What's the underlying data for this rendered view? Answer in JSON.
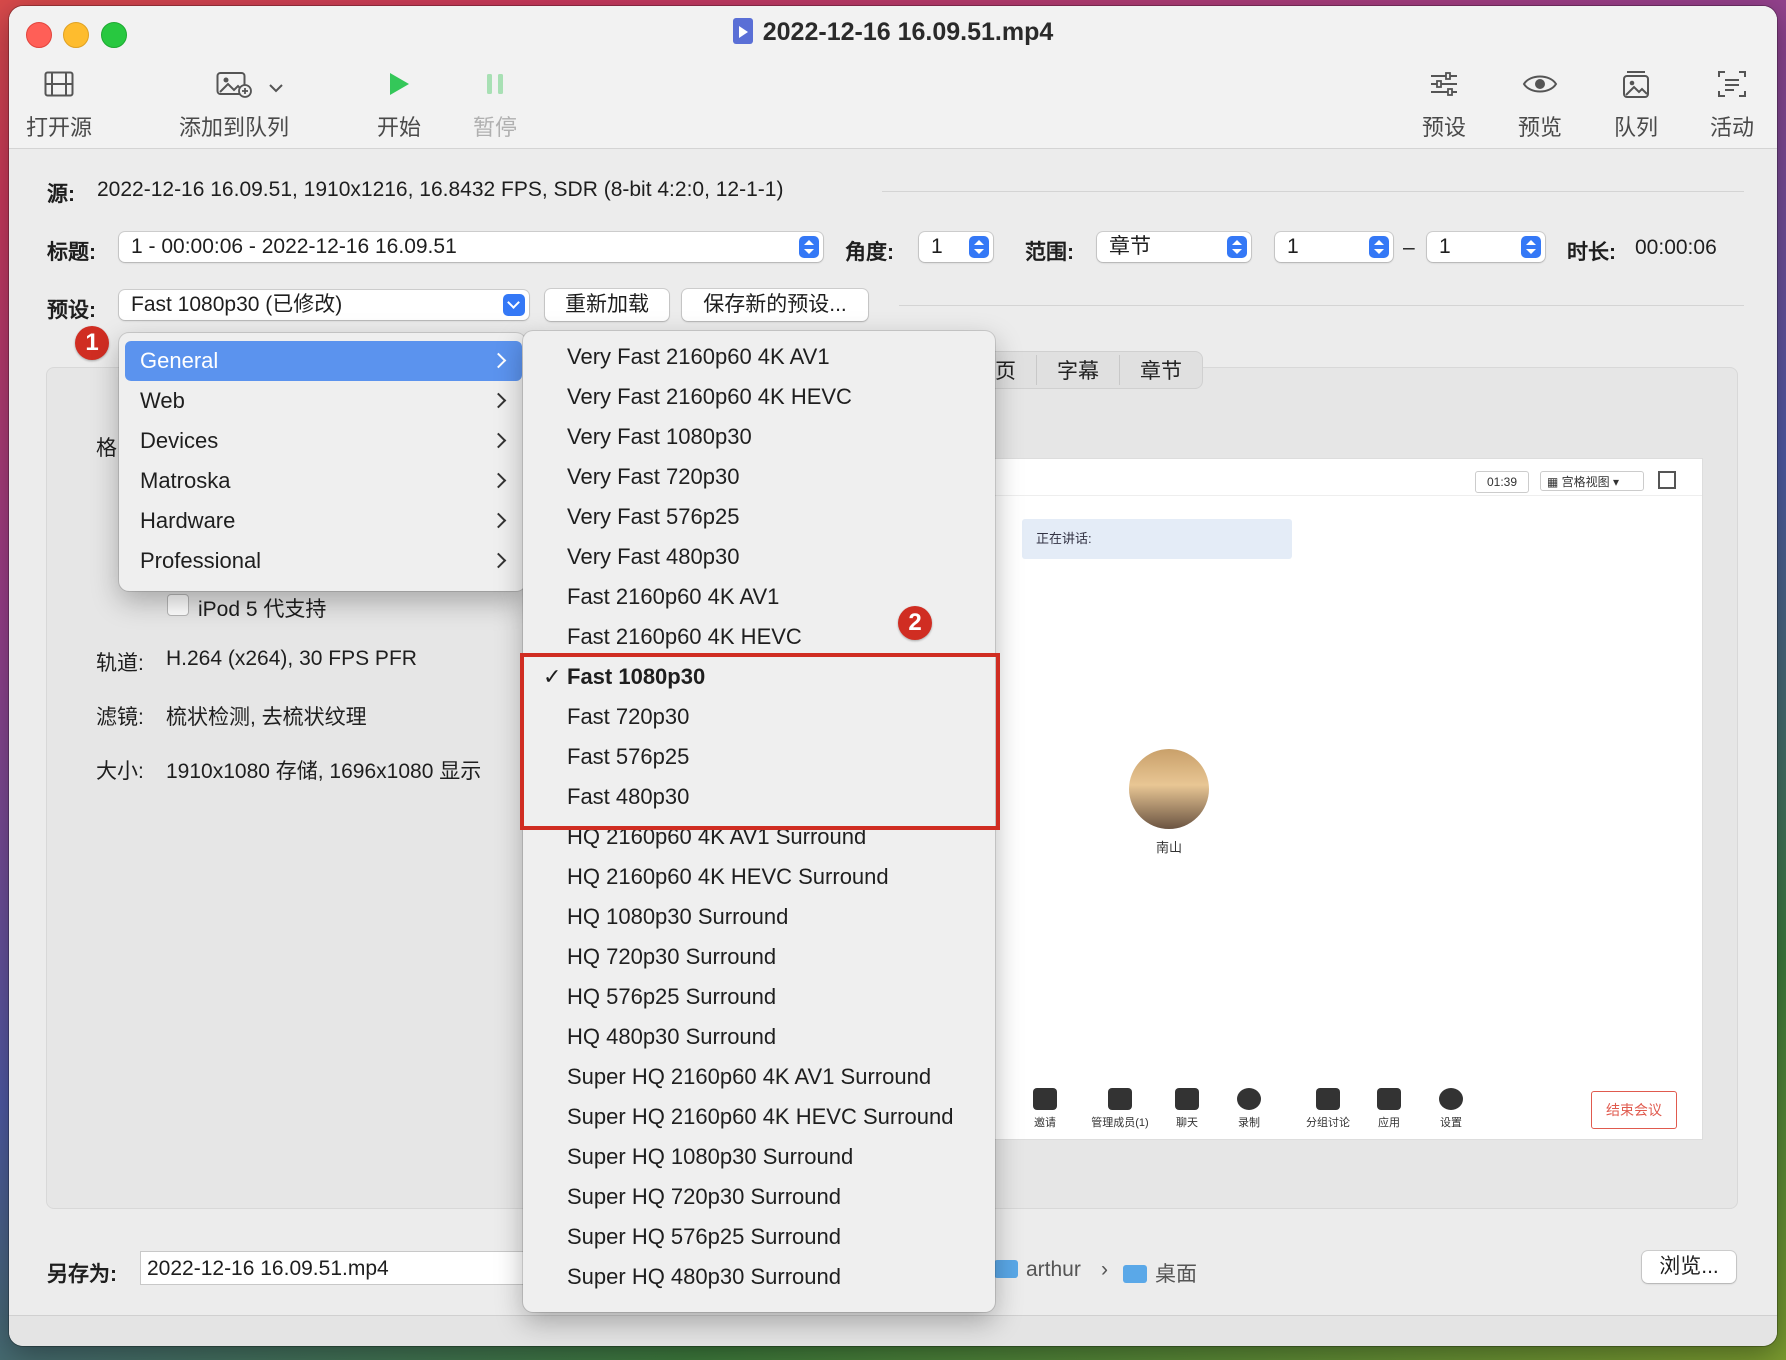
{
  "window": {
    "title": "2022-12-16 16.09.51.mp4"
  },
  "toolbar": {
    "open_source": "打开源",
    "add_to_queue": "添加到队列",
    "start": "开始",
    "pause": "暂停",
    "presets": "预设",
    "preview": "预览",
    "queue": "队列",
    "activity": "活动"
  },
  "source": {
    "label": "源:",
    "value": "2022-12-16 16.09.51, 1910x1216, 16.8432 FPS, SDR (8-bit 4:2:0, 12-1-1)"
  },
  "title_row": {
    "label": "标题:",
    "value": "1 - 00:00:06 - 2022-12-16 16.09.51",
    "angle_label": "角度:",
    "angle_value": "1",
    "range_label": "范围:",
    "range_value": "章节",
    "range_start": "1",
    "dash": "–",
    "range_end": "1",
    "duration_label": "时长:",
    "duration_value": "00:00:06"
  },
  "preset_row": {
    "label": "预设:",
    "value": "Fast 1080p30 (已修改)",
    "reload_button": "重新加载",
    "save_button": "保存新的预设..."
  },
  "tabs": [
    "页",
    "字幕",
    "章节"
  ],
  "summary": {
    "format_label": "格",
    "ipod_checkbox": "iPod 5 代支持",
    "track_label": "轨道:",
    "track_value": "H.264 (x264), 30 FPS PFR",
    "filters_label": "滤镜:",
    "filters_value": "梳状检测, 去梳状纹理",
    "size_label": "大小:",
    "size_value": "1910x1080 存储, 1696x1080 显示"
  },
  "preview": {
    "timer": "01:39",
    "grid_view": "宫格视图",
    "speaking": "正在讲话:",
    "participant": "南山",
    "end_meeting": "结束会议",
    "toolbar": [
      "邀请",
      "管理成员(1)",
      "聊天",
      "录制",
      "分组讨论",
      "应用",
      "设置"
    ]
  },
  "save_row": {
    "label": "另存为:",
    "value": "2022-12-16 16.09.51.mp4",
    "path_user": "arthur",
    "path_sep": "›",
    "path_folder": "桌面",
    "browse_button": "浏览..."
  },
  "badges": {
    "one": "1",
    "two": "2"
  },
  "menu_categories": [
    {
      "label": "General",
      "selected": true
    },
    {
      "label": "Web"
    },
    {
      "label": "Devices"
    },
    {
      "label": "Matroska"
    },
    {
      "label": "Hardware"
    },
    {
      "label": "Professional"
    }
  ],
  "menu_presets": [
    "Very Fast 2160p60 4K AV1",
    "Very Fast 2160p60 4K HEVC",
    "Very Fast 1080p30",
    "Very Fast 720p30",
    "Very Fast 576p25",
    "Very Fast 480p30",
    "Fast 2160p60 4K AV1",
    "Fast 2160p60 4K HEVC",
    "Fast 1080p30",
    "Fast 720p30",
    "Fast 576p25",
    "Fast 480p30",
    "HQ 2160p60 4K AV1 Surround",
    "HQ 2160p60 4K HEVC Surround",
    "HQ 1080p30 Surround",
    "HQ 720p30 Surround",
    "HQ 576p25 Surround",
    "HQ 480p30 Surround",
    "Super HQ 2160p60 4K AV1 Surround",
    "Super HQ 2160p60 4K HEVC Surround",
    "Super HQ 1080p30 Surround",
    "Super HQ 720p30 Surround",
    "Super HQ 576p25 Surround",
    "Super HQ 480p30 Surround"
  ],
  "checked_preset": "Fast 1080p30",
  "check_mark": "✓",
  "colors": {
    "accent": "#3478f6",
    "menu_highlight": "#5b93ee",
    "annotation_red": "#d02d22"
  }
}
